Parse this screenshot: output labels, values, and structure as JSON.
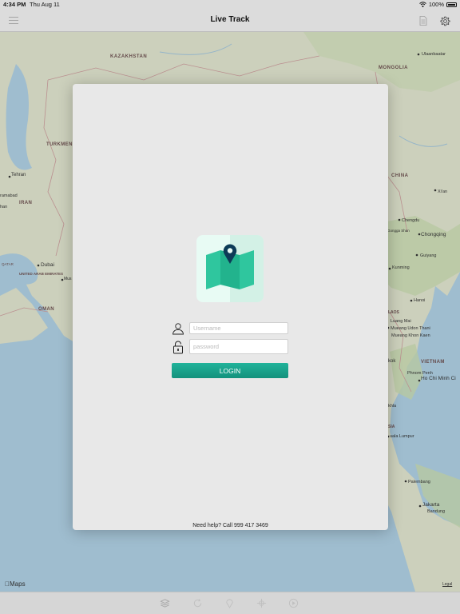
{
  "status": {
    "time": "4:34 PM",
    "date": "Thu Aug 11",
    "battery": "100%",
    "wifi_icon": "wifi-icon",
    "battery_icon": "battery-icon"
  },
  "nav": {
    "title": "Live Track",
    "menu_icon": "hamburger-icon",
    "doc_icon": "document-icon",
    "settings_icon": "gear-icon"
  },
  "map": {
    "provider_label": "Maps",
    "legal_label": "Legal",
    "place_labels": [
      "KAZAKHSTAN",
      "MONGOLIA",
      "Ulaanbaatar",
      "TURKMEN",
      "Tehran",
      "ramabad",
      "IRAN",
      "han",
      "CHINA",
      "Xi'an",
      "Chengdu",
      "Chongqing",
      "Gongga Shan",
      "Guiyang",
      "Kunming",
      "QATAR",
      "Dubai",
      "UNITED ARAB EMIRATES",
      "Mus",
      "OMAN",
      "Hanoi",
      "LAOS",
      "Luang Mai",
      "Mueang Udon Thani",
      "Mueang Khon Kaen",
      "kok",
      "VIETNAM",
      "Phnom Penh",
      "Ho Chi Minh Ci",
      "khla",
      "SIA",
      "uala Lumpur",
      "Palembang",
      "Jakarta",
      "Bandung"
    ]
  },
  "login": {
    "username_placeholder": "Username",
    "password_placeholder": "password",
    "login_label": "LOGIN",
    "help_text": "Need help? Call 999 417 3469",
    "user_icon": "user-icon",
    "lock_icon": "lock-icon",
    "logo_icon": "map-pin-logo-icon"
  },
  "toolbar": {
    "icons": [
      "layers-icon",
      "refresh-icon",
      "pin-icon",
      "crosshair-icon",
      "play-icon"
    ]
  },
  "colors": {
    "accent": "#17a58c",
    "chrome": "#dcdcdc",
    "sheet": "#e8e8e8",
    "water": "#a9c9dc",
    "land": "#d9ddc8"
  }
}
